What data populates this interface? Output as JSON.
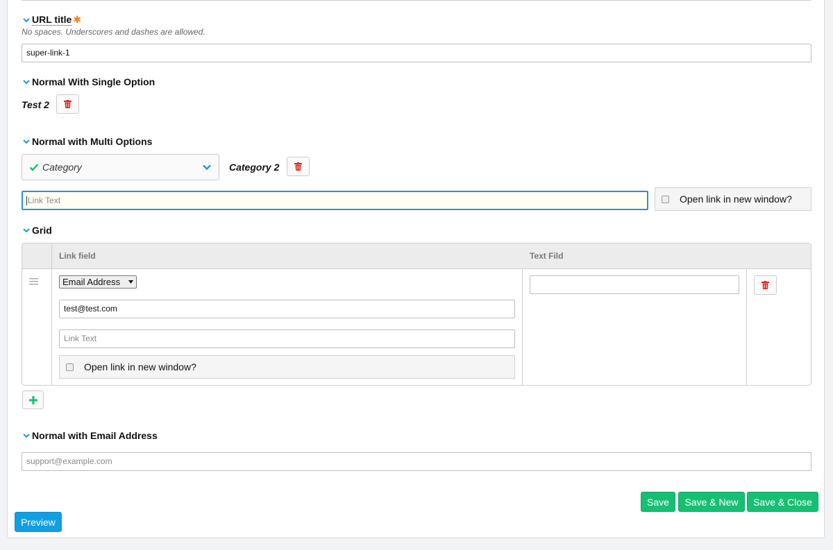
{
  "url_title": {
    "label": "URL title",
    "required_mark": "✱",
    "hint": "No spaces. Underscores and dashes are allowed.",
    "value": "super-link-1"
  },
  "single_option": {
    "label": "Normal With Single Option",
    "selected": "Test 2"
  },
  "multi_options": {
    "label": "Normal with Multi Options",
    "select_label": "Category",
    "selected": "Category 2",
    "link_text_placeholder": "Link Text",
    "open_new_window_label": "Open link in new window?"
  },
  "grid": {
    "label": "Grid",
    "columns": [
      "Link field",
      "Text Fild"
    ],
    "rows": [
      {
        "link_type": "Email Address",
        "link_value": "test@test.com",
        "link_text_placeholder": "Link Text",
        "open_new_window_label": "Open link in new window?",
        "text_field_value": ""
      }
    ]
  },
  "email_field": {
    "label": "Normal with Email Address",
    "placeholder": "support@example.com"
  },
  "actions": {
    "save": "Save",
    "save_new": "Save & New",
    "save_close": "Save & Close",
    "preview": "Preview"
  },
  "colors": {
    "accent_blue": "#109fe3",
    "save_green": "#16bf73",
    "delete_red": "#d9241c",
    "required_orange": "#f07f1a",
    "focus_border": "#2b8fd6"
  },
  "icons": [
    "chevron-down-icon",
    "trash-icon",
    "check-icon",
    "drag-handle-icon",
    "plus-icon"
  ]
}
